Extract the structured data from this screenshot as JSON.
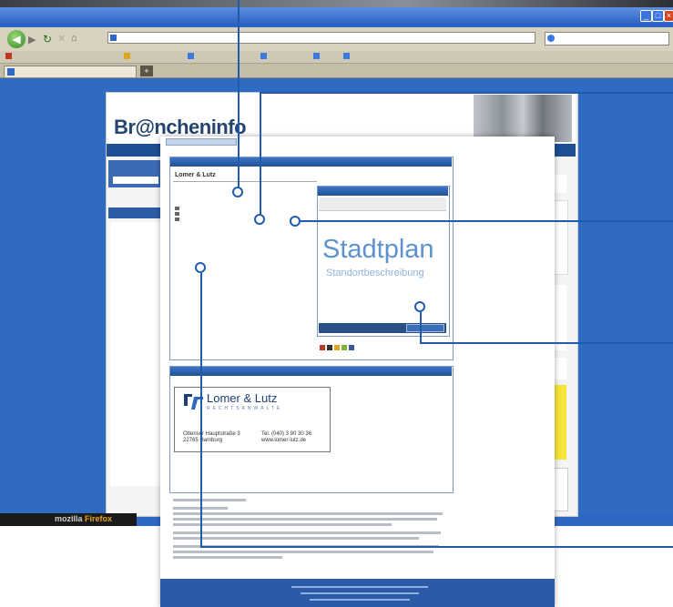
{
  "logo": "Br@ncheninfo",
  "card": {
    "company": "Lomer & Lutz",
    "map_title": "Stadtplan",
    "map_subtitle": "Standortbeschreibung"
  },
  "biz_card": {
    "name": "Lomer & Lutz",
    "subtitle": "RECHTSANWÄLTE",
    "addr1": "Ottenser Hauptstraße 3",
    "addr2": "22765 Hamburg",
    "tel": "Tel. (040) 3 90 30 36",
    "web": "www.lomer-lutz.de"
  },
  "status": {
    "logo_prefix": "mozilla",
    "logo_suffix": "Firefox"
  },
  "colors": {
    "accent": "#1f5cb0",
    "header_blue": "#1f4f95",
    "map_text": "#5e92cf"
  }
}
